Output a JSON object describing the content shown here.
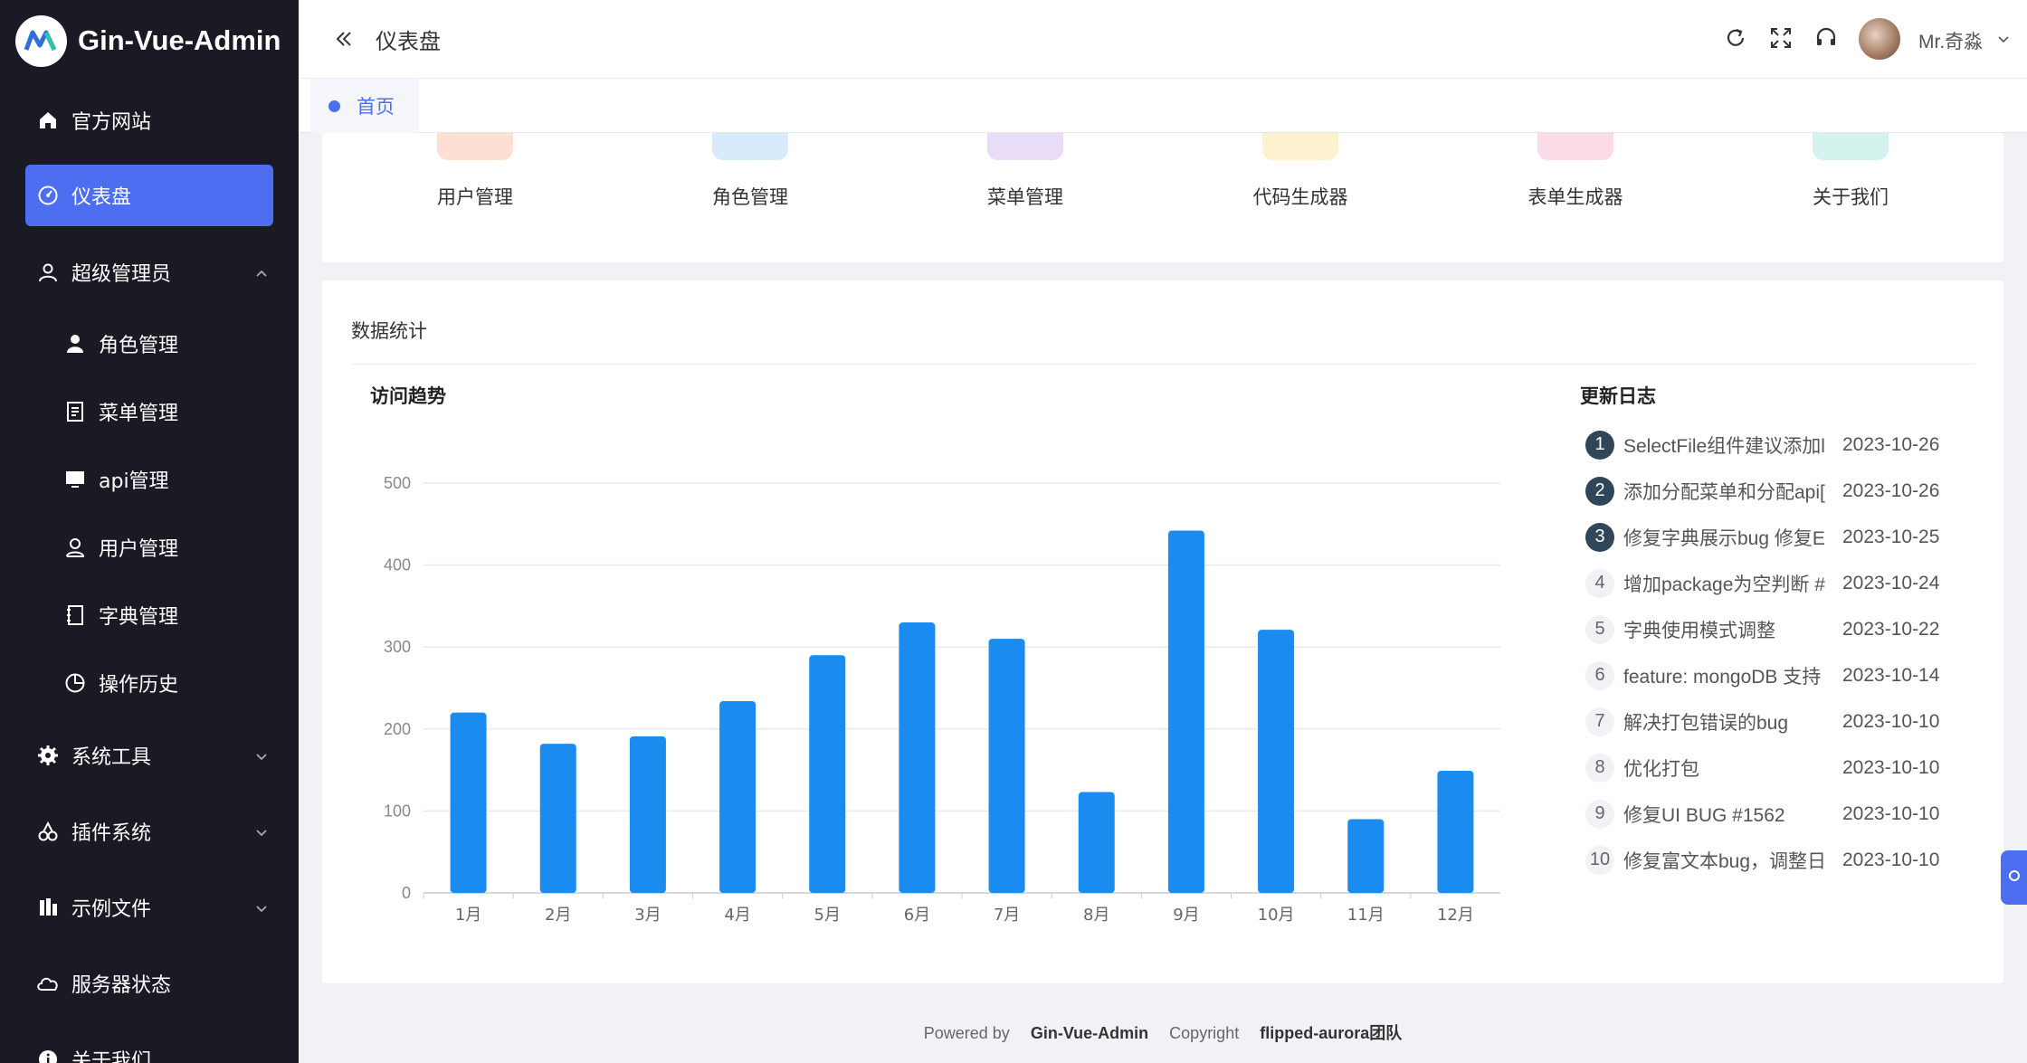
{
  "brand": {
    "title": "Gin-Vue-Admin"
  },
  "sidebar": {
    "items": [
      {
        "label": "官方网站",
        "icon": "home-icon"
      },
      {
        "label": "仪表盘",
        "icon": "dashboard-icon",
        "active": true
      },
      {
        "label": "超级管理员",
        "icon": "user-icon",
        "expanded": true
      },
      {
        "label": "角色管理",
        "icon": "person-icon"
      },
      {
        "label": "菜单管理",
        "icon": "document-icon"
      },
      {
        "label": "api管理",
        "icon": "monitor-icon"
      },
      {
        "label": "用户管理",
        "icon": "user-outline-icon"
      },
      {
        "label": "字典管理",
        "icon": "notebook-icon"
      },
      {
        "label": "操作历史",
        "icon": "pie-chart-icon"
      },
      {
        "label": "系统工具",
        "icon": "gear-icon"
      },
      {
        "label": "插件系统",
        "icon": "cherry-icon"
      },
      {
        "label": "示例文件",
        "icon": "files-icon"
      },
      {
        "label": "服务器状态",
        "icon": "cloud-icon"
      },
      {
        "label": "关于我们",
        "icon": "info-icon"
      }
    ]
  },
  "header": {
    "title": "仪表盘",
    "username": "Mr.奇淼"
  },
  "tabs": [
    {
      "label": "首页"
    }
  ],
  "quick_entry": {
    "items": [
      {
        "label": "用户管理",
        "color": "#fde0d2"
      },
      {
        "label": "角色管理",
        "color": "#d8ebfc"
      },
      {
        "label": "菜单管理",
        "color": "#e8dcf8"
      },
      {
        "label": "代码生成器",
        "color": "#fdf1cf"
      },
      {
        "label": "表单生成器",
        "color": "#fcdbe8"
      },
      {
        "label": "关于我们",
        "color": "#d4f3ef"
      }
    ]
  },
  "stats": {
    "title": "数据统计",
    "chart_title": "访问趋势",
    "log_title": "更新日志",
    "logs": [
      {
        "num": "1",
        "text": "SelectFile组件建议添加l",
        "date": "2023-10-26"
      },
      {
        "num": "2",
        "text": "添加分配菜单和分配api[",
        "date": "2023-10-26"
      },
      {
        "num": "3",
        "text": "修复字典展示bug 修复E",
        "date": "2023-10-25"
      },
      {
        "num": "4",
        "text": "增加package为空判断 #",
        "date": "2023-10-24"
      },
      {
        "num": "5",
        "text": "字典使用模式调整",
        "date": "2023-10-22"
      },
      {
        "num": "6",
        "text": "feature: mongoDB 支持",
        "date": "2023-10-14"
      },
      {
        "num": "7",
        "text": "解决打包错误的bug",
        "date": "2023-10-10"
      },
      {
        "num": "8",
        "text": "优化打包",
        "date": "2023-10-10"
      },
      {
        "num": "9",
        "text": "修复UI BUG #1562",
        "date": "2023-10-10"
      },
      {
        "num": "10",
        "text": "修复富文本bug，调整日",
        "date": "2023-10-10"
      }
    ]
  },
  "chart_data": {
    "type": "bar",
    "categories": [
      "1月",
      "2月",
      "3月",
      "4月",
      "5月",
      "6月",
      "7月",
      "8月",
      "9月",
      "10月",
      "11月",
      "12月"
    ],
    "values": [
      220,
      182,
      191,
      234,
      290,
      330,
      310,
      123,
      442,
      321,
      90,
      149
    ],
    "ylim": [
      0,
      500
    ],
    "yticks": [
      0,
      100,
      200,
      300,
      400,
      500
    ],
    "grid": true,
    "color": "#1a8cf0"
  },
  "footer": {
    "powered_by": "Powered by",
    "product": "Gin-Vue-Admin",
    "copyright": "Copyright",
    "team": "flipped-aurora团队"
  }
}
